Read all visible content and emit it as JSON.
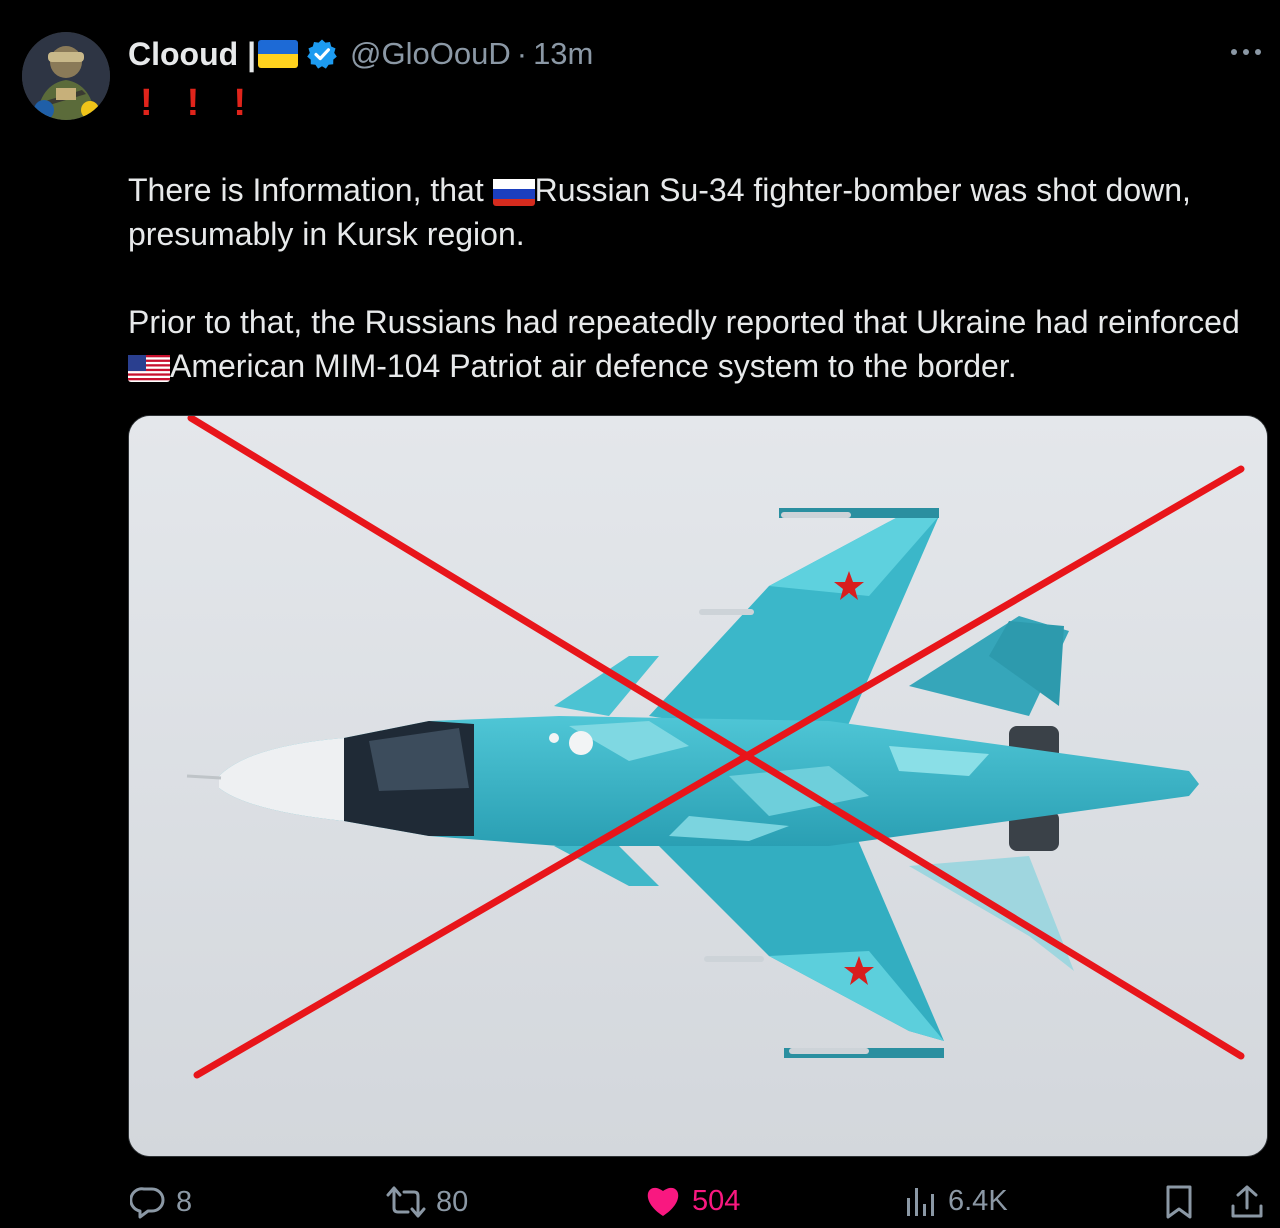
{
  "tweet": {
    "author": {
      "display_name": "Clooud |",
      "handle": "@GloOouD",
      "time_separator": "·",
      "time": "13m",
      "verified": true
    },
    "exclamations": [
      "!",
      "!",
      "!"
    ],
    "paragraphs": [
      {
        "before_flag": "There is Information, that ",
        "flag": "russia-flag",
        "after_flag": "Russian Su-34 fighter-bomber was shot down, presumably in Kursk region."
      },
      {
        "before_flag": "Prior to that, the Russians had repeatedly reported that Ukraine had reinforced ",
        "flag": "usa-flag",
        "after_flag": "American MIM-104 Patriot air defence system to the border."
      }
    ],
    "media": {
      "subject": "su-34-jet-image",
      "overlay": "red-cross-mark"
    },
    "actions": {
      "replies": "8",
      "reposts": "80",
      "likes": "504",
      "views": "6.4K"
    }
  },
  "colors": {
    "background": "#000000",
    "text_primary": "#e7e9ea",
    "text_secondary": "#8b98a5",
    "like_active": "#f91880",
    "verified_badge": "#1d9bf0",
    "exclamation": "#e0241b",
    "cross": "#e8151a"
  }
}
